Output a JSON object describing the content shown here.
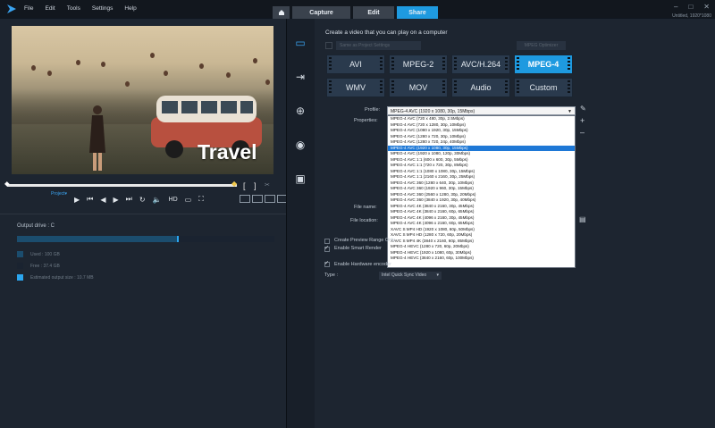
{
  "menu": [
    "File",
    "Edit",
    "Tools",
    "Settings",
    "Help"
  ],
  "tabs": {
    "capture": "Capture",
    "edit": "Edit",
    "share": "Share"
  },
  "project_info": "Untitled, 1920*1080",
  "preview": {
    "overlay_text": "Travel",
    "project_label": "Project▾"
  },
  "output": {
    "drive_label": "Output drive : C",
    "used": "Used : 100 GB",
    "free": "Free : 37.4 GB",
    "estimated": "Estimated output size : 10.7 MB",
    "used_fraction": 0.62
  },
  "share": {
    "heading": "Create a video that you can play on a computer",
    "project_settings": "Same as Project Settings",
    "more_options": "MPEG Optimizer",
    "formats": [
      "AVI",
      "MPEG-2",
      "AVC/H.264",
      "MPEG-4",
      "WMV",
      "MOV",
      "Audio",
      "Custom"
    ],
    "selected_format": "MPEG-4",
    "profile_label": "Profile:",
    "profile_value": "MPEG-4 AVC (1920 x 1080, 30p, 15Mbps)",
    "properties_label": "Properties:",
    "file_name_label": "File name:",
    "file_location_label": "File location:",
    "preview_range": "Create Preview Range Only",
    "smart_render": "Enable Smart Render",
    "hw_encode": "Enable Hardware encoder",
    "type_label": "Type :",
    "type_value": "Intel Quick Sync Video",
    "profile_options": [
      "MPEG-4 AVC (720 x 480, 30p, 2.5Mbps)",
      "MPEG-4 AVC (720 x 1280, 30p, 10Mbps)",
      "MPEG-4 AVC (1080 x 1920, 30p, 15Mbps)",
      "MPEG-4 AVC (1280 x 720, 30p, 10Mbps)",
      "MPEG-4 AVC (1280 x 720, 24p, 40Mbps)",
      "MPEG-4 AVC (1920 x 1080, 30p, 15Mbps)",
      "MPEG-4 AVC (1920 x 1080, 120p, 30Mbps)",
      "MPEG-4 AVC 1:1 (600 x 600, 30p, 5Mbps)",
      "MPEG-4 AVC 1:1 (720 x 720, 30p, 8Mbps)",
      "MPEG-4 AVC 1:1 (1080 x 1080, 30p, 15Mbps)",
      "MPEG-4 AVC 1:1 (2160 x 2160, 30p, 25Mbps)",
      "MPEG-4 AVC 360 (1280 x 640, 30p, 10Mbps)",
      "MPEG-4 AVC 360 (1920 x 960, 30p, 15Mbps)",
      "MPEG-4 AVC 360 (2560 x 1280, 30p, 20Mbps)",
      "MPEG-4 AVC 360 (3840 x 1920, 30p, 40Mbps)",
      "MPEG-4 AVC 4K (3840 x 2160, 30p, 45Mbps)",
      "MPEG-4 AVC 4K (3840 x 2160, 60p, 65Mbps)",
      "MPEG-4 AVC 4K (4096 x 2160, 30p, 45Mbps)",
      "MPEG-4 AVC 4K (4096 x 2160, 60p, 65Mbps)",
      "XAVC S MP4 HD (1920 x 1080, 60p, 50Mbps)",
      "XAVC S MP4 HD (1280 x 720, 60p, 20Mbps)",
      "XAVC S MP4 4K (3840 x 2160, 60p, 85Mbps)",
      "MPEG-4 HEVC (1280 x 720, 60p, 20Mbps)",
      "MPEG-4 HEVC (1920 x 1080, 60p, 30Mbps)",
      "MPEG-4 HEVC (3840 x 2160, 60p, 100Mbps)"
    ],
    "highlighted_index": 5
  },
  "colors": {
    "accent": "#1e9ae0",
    "panel": "#1d2530"
  }
}
